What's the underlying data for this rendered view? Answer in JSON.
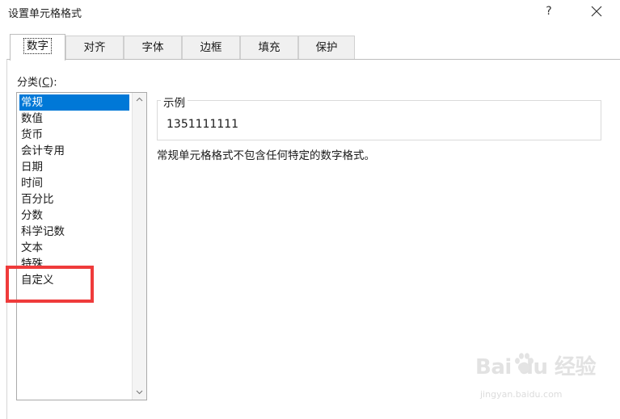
{
  "dialog": {
    "title": "设置单元格格式",
    "help": "?"
  },
  "tabs": [
    {
      "label": "数字",
      "active": true
    },
    {
      "label": "对齐"
    },
    {
      "label": "字体"
    },
    {
      "label": "边框"
    },
    {
      "label": "填充"
    },
    {
      "label": "保护"
    }
  ],
  "category": {
    "label_prefix": "分类(",
    "label_key": "C",
    "label_suffix": "):",
    "items": [
      "常规",
      "数值",
      "货币",
      "会计专用",
      "日期",
      "时间",
      "百分比",
      "分数",
      "科学记数",
      "文本",
      "特殊",
      "自定义"
    ],
    "selected": "常规"
  },
  "sample": {
    "legend": "示例",
    "value": "1351111111"
  },
  "description": "常规单元格格式不包含任何特定的数字格式。",
  "annotation": {
    "highlight_color": "#ef3b3b"
  },
  "watermark": {
    "brand": "Bai  du 经验",
    "url": "jingyan.baidu.com"
  },
  "colors": {
    "selection": "#0078d7"
  }
}
